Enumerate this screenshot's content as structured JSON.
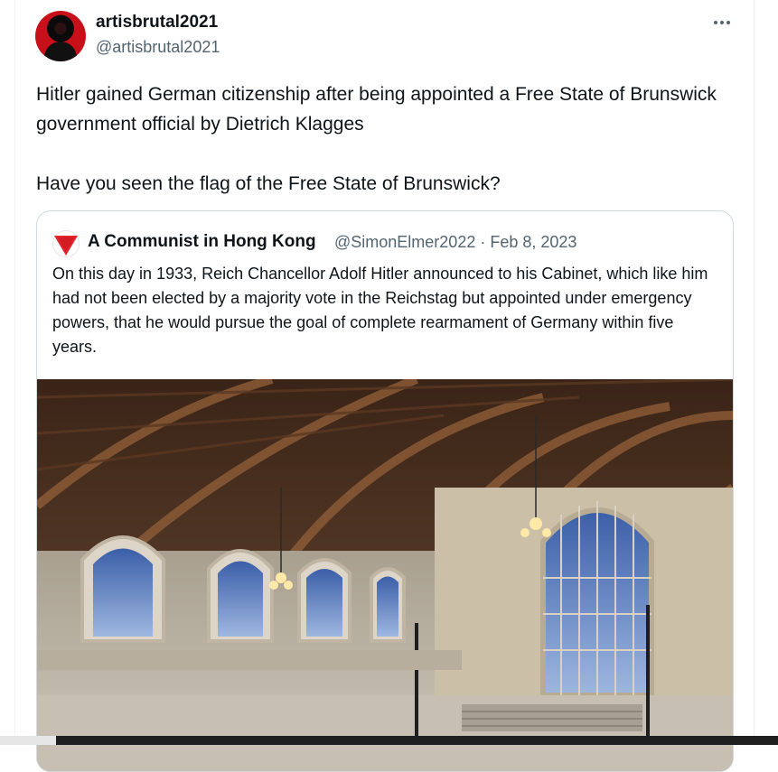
{
  "tweet": {
    "author": {
      "display_name": "artisbrutal2021",
      "handle": "@artisbrutal2021",
      "avatar_icon": "avatar-icon"
    },
    "more_icon": "more-horizontal-icon",
    "text": "Hitler gained German citizenship after being appointed a Free State of Brunswick government official by Dietrich Klagges\n\nHave you seen the flag of the Free State of Brunswick?"
  },
  "quote": {
    "author": {
      "display_name": "A Communist in Hong Kong",
      "handle": "@SimonElmer2022",
      "date": "Feb 8, 2023",
      "avatar_icon": "red-triangle-icon"
    },
    "meta": "@SimonElmer2022 · Feb 8, 2023",
    "text": "On this day in 1933, Reich Chancellor Adolf Hitler announced to his Cabinet, which like him had not been elected by a majority vote in the Reichstag but appointed under emergency powers, that he would pursue the goal of complete rearmament of Germany within five years.",
    "media": "photo"
  },
  "colors": {
    "text_primary": "#0f1419",
    "text_secondary": "#536471",
    "border": "#cfd9de",
    "accent_red": "#e0252b"
  }
}
